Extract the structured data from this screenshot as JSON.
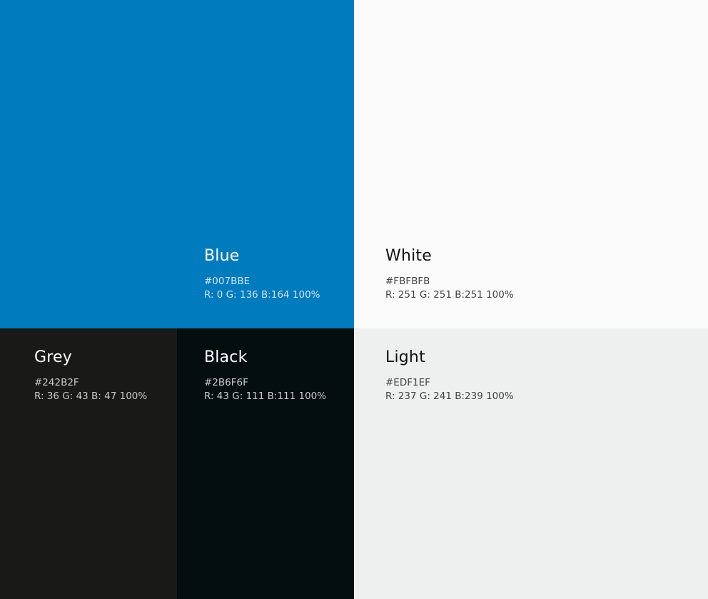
{
  "swatches": {
    "blue": {
      "name": "Blue",
      "hex": "#007BBE",
      "rgb": "R: 0 G: 136 B:164 100%",
      "fill": "#007bbe"
    },
    "white": {
      "name": "White",
      "hex": "#FBFBFB",
      "rgb": "R: 251 G: 251 B:251 100%",
      "fill": "#fbfbfb"
    },
    "grey": {
      "name": "Grey",
      "hex": "#242B2F",
      "rgb": "R: 36 G: 43 B: 47 100%",
      "fill": "#191a17"
    },
    "black": {
      "name": "Black",
      "hex": "#2B6F6F",
      "rgb": "R: 43 G: 111 B:111 100%",
      "fill": "#040e0f"
    },
    "light": {
      "name": "Light",
      "hex": "#EDF1EF",
      "rgb": "R: 237 G: 241 B:239 100%",
      "fill": "#edf0ef"
    }
  }
}
